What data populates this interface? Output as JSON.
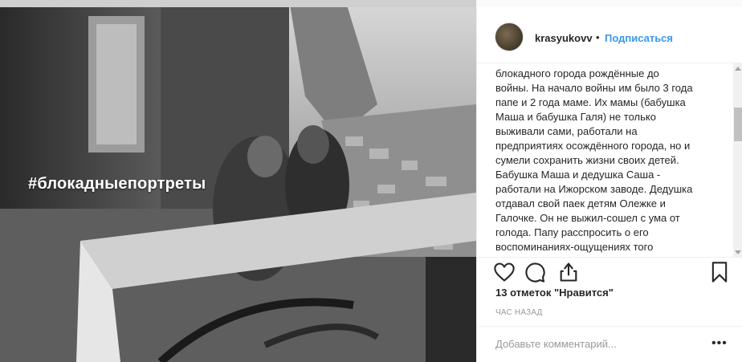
{
  "post": {
    "image_hashtag": "#блокадныепортреты"
  },
  "header": {
    "username": "krasyukovv",
    "separator": "•",
    "follow_label": "Подписаться"
  },
  "caption": {
    "text": "блокадного города рождённые до\nвойны. На начало войны им было 3 года\nпапе и 2 года маме. Их мамы (бабушка\nМаша и бабушка Галя) не только\nвыживали сами, работали на\nпредприятиях осождённого города, но и\nсумели сохранить жизни своих детей.\nБабушка Маша и дедушка Саша -\nработали на Ижорском заводе. Дедушка\nотдавал свой паек детям Олежке и\nГалочке. Он не выжил-сошел с ума от\nголода. Папу расспросить о его\nвоспоминаниях-ощущениях того"
  },
  "actions": {
    "like_icon": "heart-icon",
    "comment_icon": "comment-icon",
    "share_icon": "share-icon",
    "save_icon": "bookmark-icon"
  },
  "likes_text": "13 отметок \"Нравится\"",
  "timestamp": "ЧАС НАЗАД",
  "comment": {
    "placeholder": "Добавьте комментарий...",
    "more_label": "•••"
  }
}
